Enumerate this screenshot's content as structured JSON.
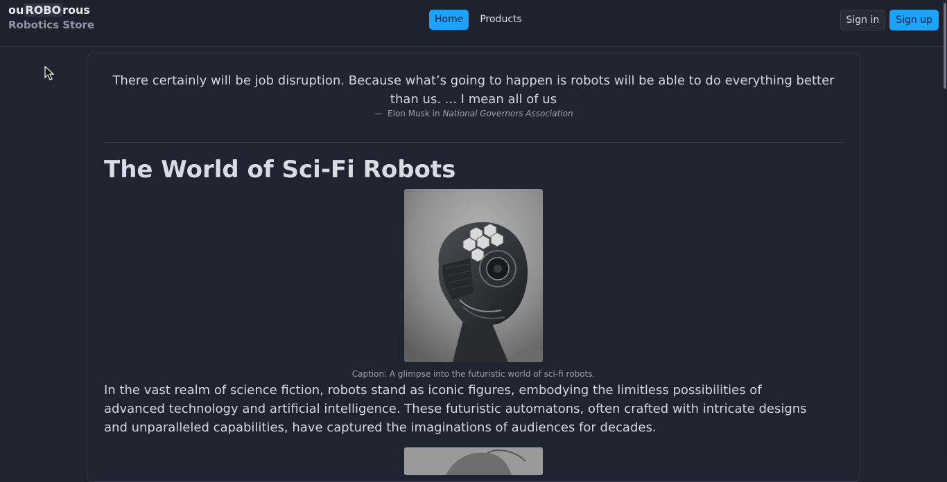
{
  "header": {
    "brand_prefix": "ou",
    "brand_middle": "ROBO",
    "brand_suffix": "rous",
    "brand_subtitle": "Robotics Store",
    "nav": [
      {
        "label": "Home",
        "active": true
      },
      {
        "label": "Products",
        "active": false
      }
    ],
    "sign_in": "Sign in",
    "sign_up": "Sign up"
  },
  "content": {
    "quote": "There certainly will be job disruption. Because what’s going to happen is robots will be able to do everything better than us. ... I mean all of us",
    "attribution_dash": "—",
    "attribution_author": "Elon Musk in",
    "attribution_source": "National Governors Association",
    "heading": "The World of Sci-Fi Robots",
    "caption": "Caption: A glimpse into the futuristic world of sci-fi robots.",
    "paragraph": "In the vast realm of science fiction, robots stand as iconic figures, embodying the limitless possibilities of advanced technology and artificial intelligence. These futuristic automatons, often crafted with intricate designs and unparalleled capabilities, have captured the imaginations of audiences for decades."
  },
  "colors": {
    "background": "#1f2430",
    "accent": "#1aa3ff",
    "border": "#363c49"
  },
  "icons": [
    "mouse-cursor-icon"
  ]
}
